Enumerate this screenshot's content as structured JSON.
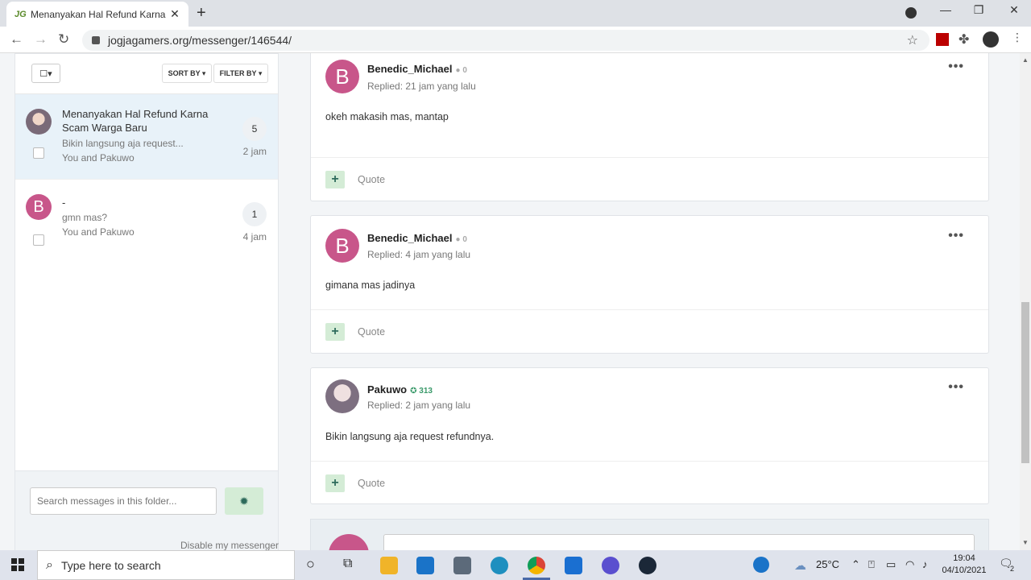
{
  "browser": {
    "tab_favicon": "JG",
    "tab_title": "Menanyakan Hal Refund Karna Scam Warga Baru",
    "tab_close": "✕",
    "new_tab": "+",
    "url": "jogjagamers.org/messenger/146544/"
  },
  "left_panel": {
    "select_all_label": "☐▾",
    "sort_label": "SORT BY ▾",
    "filter_label": "FILTER BY ▾",
    "conversations": [
      {
        "title": "Menanyakan Hal Refund Karna Scam Warga Baru",
        "snippet": "Bikin langsung aja request...",
        "participants": "You and Pakuwo",
        "count": "5",
        "time": "2 jam",
        "avatar": "image"
      },
      {
        "title": "-",
        "snippet": "gmn mas?",
        "participants": "You and Pakuwo",
        "count": "1",
        "time": "4 jam",
        "avatar": "B"
      }
    ],
    "search_placeholder": "Search messages in this folder...",
    "disable_link": "Disable my messenger"
  },
  "messages": [
    {
      "author": "Benedic_Michael",
      "rep": "● 0",
      "replied": "Replied: 21 jam yang lalu",
      "body": "okeh makasih mas, mantap",
      "avatar": "B",
      "quote": "Quote",
      "more": "•••"
    },
    {
      "author": "Benedic_Michael",
      "rep": "● 0",
      "replied": "Replied: 4 jam yang lalu",
      "body": "gimana mas jadinya",
      "avatar": "B",
      "quote": "Quote",
      "more": "•••"
    },
    {
      "author": "Pakuwo",
      "rep": "✪ 313",
      "replied": "Replied: 2 jam yang lalu",
      "body": "Bikin langsung aja request refundnya.",
      "avatar": "image",
      "quote": "Quote",
      "more": "•••"
    }
  ],
  "taskbar": {
    "search_text": "Type here to search",
    "weather": "25°C",
    "time": "19:04",
    "date": "04/10/2021",
    "notif_count": "2"
  },
  "colors": {
    "avatar_b": "#c8568a",
    "action_green": "#d4ecd6",
    "active_conv": "#e8f2f9"
  }
}
